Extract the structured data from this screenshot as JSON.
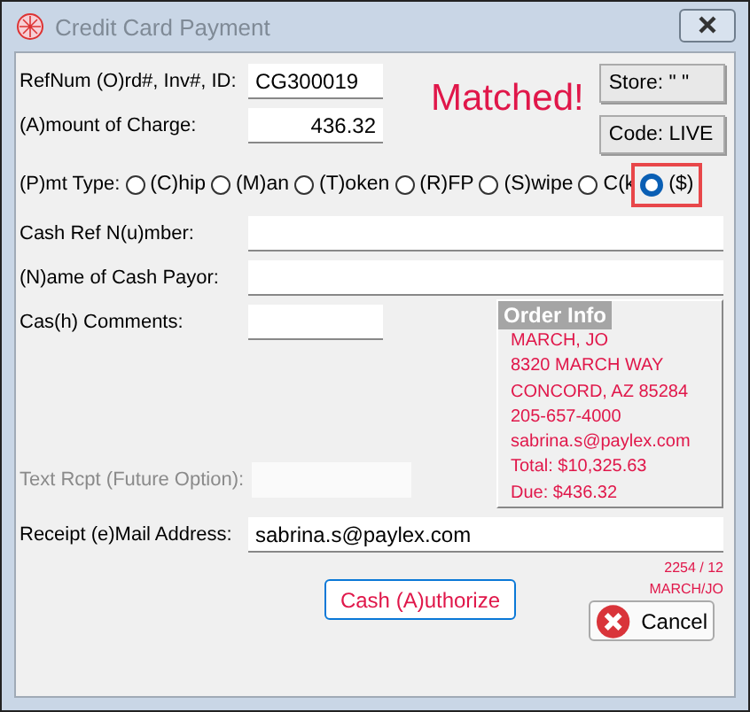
{
  "window": {
    "title": "Credit Card Payment"
  },
  "refnum": {
    "label": "RefNum (O)rd#, Inv#, ID:",
    "value": "CG300019"
  },
  "amount": {
    "label": "(A)mount of Charge:",
    "value": "436.32"
  },
  "match_status": "Matched!",
  "store_button": "Store: \" \"",
  "code_button": "Code: LIVE",
  "payment_type": {
    "label": "(P)mt Type:",
    "options": [
      {
        "label": "(C)hip",
        "selected": false,
        "highlighted": false
      },
      {
        "label": "(M)an",
        "selected": false,
        "highlighted": false
      },
      {
        "label": "(T)oken",
        "selected": false,
        "highlighted": false
      },
      {
        "label": "(R)FP",
        "selected": false,
        "highlighted": false
      },
      {
        "label": "(S)wipe",
        "selected": false,
        "highlighted": false
      },
      {
        "label": "C(k",
        "selected": false,
        "highlighted": false
      },
      {
        "label": "($)",
        "selected": true,
        "highlighted": true
      }
    ]
  },
  "cash_ref": {
    "label": "Cash Ref N(u)mber:"
  },
  "payor": {
    "label": "(N)ame of Cash Payor:"
  },
  "comments": {
    "label": "Cas(h) Comments:"
  },
  "text_receipt": {
    "label": "Text Rcpt (Future Option):",
    "disabled": true
  },
  "email": {
    "label": "Receipt (e)Mail Address:",
    "value": "sabrina.s@paylex.com"
  },
  "order_info": {
    "title": "Order Info",
    "lines": [
      "MARCH, JO",
      "8320 MARCH WAY",
      "CONCORD, AZ  85284",
      "205-657-4000",
      "sabrina.s@paylex.com",
      "Total: $10,325.63",
      "Due: $436.32"
    ]
  },
  "footer_notes": [
    "2254 / 12",
    "MARCH/JO"
  ],
  "buttons": {
    "authorize": "Cash (A)uthorize",
    "cancel": "Cancel"
  }
}
